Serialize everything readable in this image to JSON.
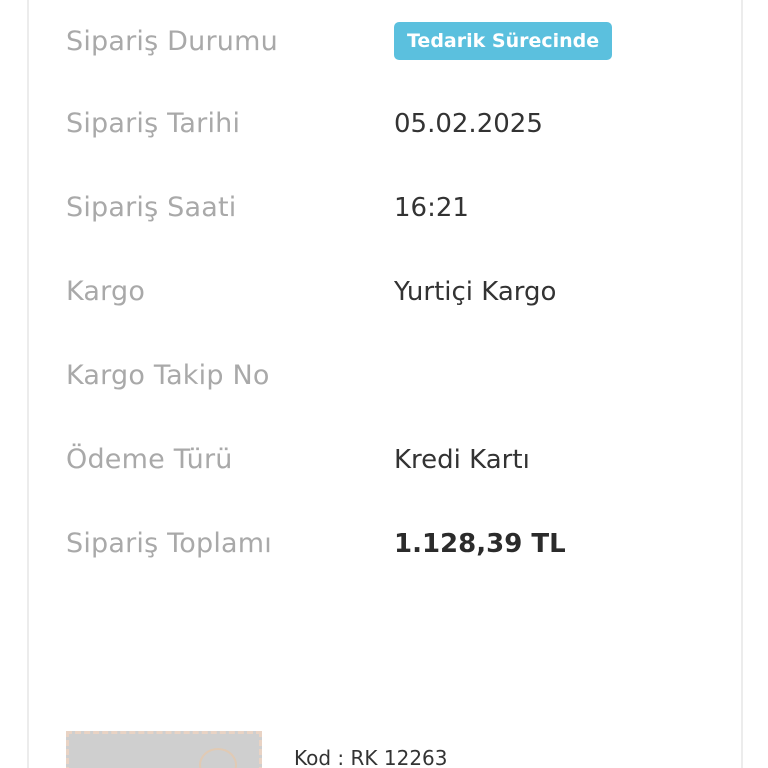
{
  "order": {
    "rows": [
      {
        "label": "Sipariş Durumu",
        "badge": "Tedarik Sürecinde"
      },
      {
        "label": "Sipariş Tarihi",
        "value": "05.02.2025"
      },
      {
        "label": "Sipariş Saati",
        "value": "16:21"
      },
      {
        "label": "Kargo",
        "value": "Yurtiçi Kargo"
      },
      {
        "label": "Kargo Takip No",
        "value": ""
      },
      {
        "label": "Ödeme Türü",
        "value": "Kredi Kartı"
      },
      {
        "label": "Sipariş Toplamı",
        "value": "1.128,39 TL"
      }
    ]
  },
  "product": {
    "code_text": "Kod : RK 12263"
  },
  "colors": {
    "badge_background": "#5bc0de",
    "label_text": "#a9a9a9",
    "value_text": "#333333"
  }
}
